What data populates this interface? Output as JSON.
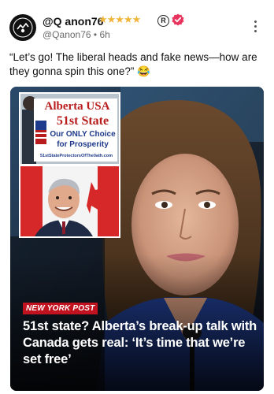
{
  "author": {
    "display_name": "@Q anon76",
    "stars": "★★★★★",
    "reg_mark": "R",
    "handle": "@Qanon76",
    "separator": "•",
    "time": "6h"
  },
  "post": {
    "text": "“Let’s go! The liberal heads and fake news—how are they gonna spin this one?” 😂"
  },
  "media": {
    "sign": {
      "line1": "Alberta USA",
      "line2": "51st State",
      "line3": "Our ONLY Choice",
      "line4": "for Prosperity",
      "footer": "51stStateProtectorsOfThe0ath.com"
    },
    "source_badge": "NEW YORK POST",
    "headline": "51st state? Alberta’s break-up talk with Canada gets real: ‘It’s time that we’re set free’"
  },
  "colors": {
    "star": "#f2b53a",
    "verified": "#e8345e",
    "badge": "#c1121f",
    "sign_blue": "#1e3a8a",
    "sign_red": "#b91c1c"
  },
  "icons": {
    "avatar": "avatar-logo",
    "verified": "verified-badge-icon",
    "menu": "more-options-icon"
  }
}
